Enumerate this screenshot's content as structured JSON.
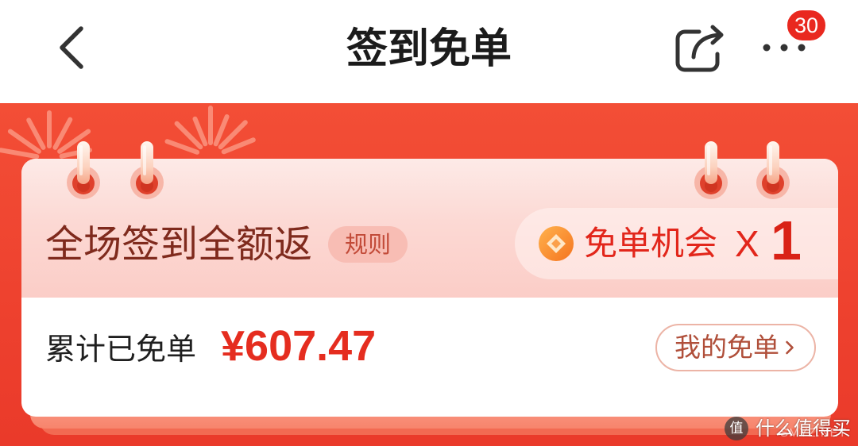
{
  "header": {
    "title": "签到免单",
    "badge_count": 30,
    "icons": {
      "back": "chevron-left-icon",
      "share": "share-icon",
      "more": "more-dots-icon"
    }
  },
  "checkin_card": {
    "headline": "全场签到全额返",
    "rules_label": "规则",
    "free_chance": {
      "icon": "coin-icon",
      "label": "免单机会",
      "multiplier": "X",
      "count": 1
    },
    "total_label": "累计已免单",
    "total_amount": "¥607.47",
    "my_orders_button": {
      "label": "我的免单",
      "icon": "chevron-right-icon"
    }
  },
  "watermark": {
    "logo_char": "值",
    "brand": "什么值得买",
    "overlay": "SMYZ.NET"
  },
  "colors": {
    "banner_red": "#ee422f",
    "accent_red": "#e2261b",
    "amount_red": "#e52d1f",
    "headline_brown": "#7f2a1d",
    "card_pink": "#fcd9d4",
    "badge_red": "#e9281f",
    "button_text": "#b04f3a"
  }
}
